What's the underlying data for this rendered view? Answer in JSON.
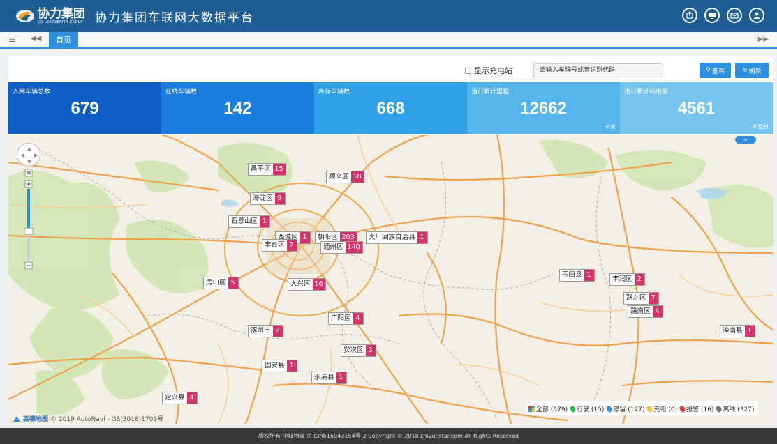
{
  "header": {
    "logo_cn": "协力集团",
    "logo_en": "CO-LEADZENITH GROUP",
    "title": "协力集团车联网大数据平台",
    "icons": [
      "export-icon",
      "screen-icon",
      "mail-icon",
      "user-icon"
    ]
  },
  "tabbar": {
    "home_tab": "首页"
  },
  "toolbar": {
    "charging_label": "显示充电站",
    "search_placeholder": "请输入车牌号或者识别代码",
    "query_label": "查询",
    "refresh_label": "刷新"
  },
  "stats": [
    {
      "label": "入网车辆总数",
      "value": "679",
      "unit": "",
      "color": "#0f5fc4"
    },
    {
      "label": "在线车辆数",
      "value": "142",
      "unit": "",
      "color": "#1a7fdc"
    },
    {
      "label": "库存车辆数",
      "value": "668",
      "unit": "",
      "color": "#2f9fe6"
    },
    {
      "label": "当日累计里程",
      "value": "12662",
      "unit": "千米",
      "color": "#55b4ea"
    },
    {
      "label": "当日累计耗电量",
      "value": "4561",
      "unit": "千瓦时",
      "color": "#74c4ee"
    }
  ],
  "map": {
    "collapse_label": "«",
    "markers": [
      {
        "name": "昌平区",
        "count": "15"
      },
      {
        "name": "顺义区",
        "count": "18"
      },
      {
        "name": "海淀区",
        "count": "9"
      },
      {
        "name": "石景山区",
        "count": "1"
      },
      {
        "name": "西城区",
        "count": "1"
      },
      {
        "name": "朝阳区",
        "count": "203"
      },
      {
        "name": "大厂回族自治县",
        "count": "1"
      },
      {
        "name": "丰台区",
        "count": "7"
      },
      {
        "name": "通州区",
        "count": "140"
      },
      {
        "name": "房山区",
        "count": "5"
      },
      {
        "name": "大兴区",
        "count": "16"
      },
      {
        "name": "玉田县",
        "count": "1"
      },
      {
        "name": "丰润区",
        "count": "2"
      },
      {
        "name": "路北区",
        "count": "7"
      },
      {
        "name": "路南区",
        "count": "4"
      },
      {
        "name": "广阳区",
        "count": "4"
      },
      {
        "name": "涿州市",
        "count": "2"
      },
      {
        "name": "安次区",
        "count": "3"
      },
      {
        "name": "固安县",
        "count": "1"
      },
      {
        "name": "永清县",
        "count": "1"
      },
      {
        "name": "定兴县",
        "count": "4"
      },
      {
        "name": "滦南县",
        "count": "1"
      }
    ],
    "attribution_logo": "高德地图",
    "attribution": "© 2019 AutoNavi - GS(2018)1709号"
  },
  "legend": [
    {
      "label": "全部 (679)",
      "color": "#3a7bd5"
    },
    {
      "label": "行驶 (15)",
      "color": "#2db84d"
    },
    {
      "label": "停留 (127)",
      "color": "#3b8fe0"
    },
    {
      "label": "充电 (0)",
      "color": "#f2c230"
    },
    {
      "label": "报警 (16)",
      "color": "#e53935"
    },
    {
      "label": "离线 (327)",
      "color": "#777777"
    }
  ],
  "footer": {
    "text": "版权所有·中城物流    京ICP备16043154号-2    Copyright © 2018 zhiyunstar.com All Rights Reserved"
  }
}
